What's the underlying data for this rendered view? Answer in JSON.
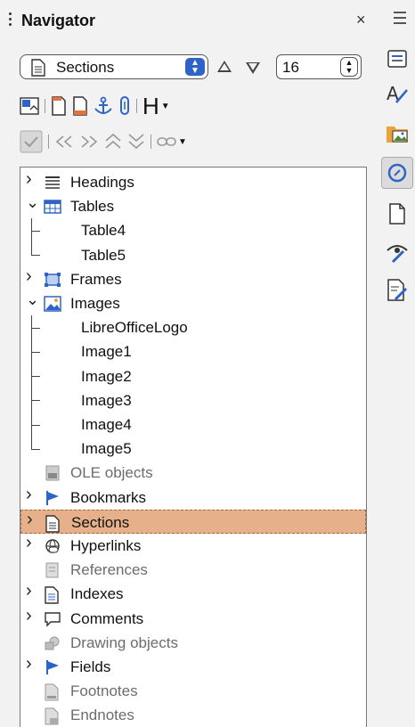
{
  "window": {
    "title": "Navigator",
    "close_glyph": "×",
    "menu_icon": "hamburger-menu-icon"
  },
  "toolbar_row1": {
    "content_type_select": {
      "value": "Sections",
      "icon": "section-icon"
    },
    "heading_level": {
      "value": "16"
    }
  },
  "toolbar_row2": {
    "icons": [
      "toggle-icon",
      "page-icon",
      "page-icon",
      "anchor-icon",
      "attachment-icon",
      "heading-level-icon"
    ],
    "heading_glyph": "H"
  },
  "toolbar_row3": {
    "icons": [
      "checkbox-icon",
      "double-left-arrow-icon",
      "double-right-arrow-icon",
      "promote-chapter-icon",
      "demote-chapter-icon",
      "link-icon"
    ]
  },
  "tree": {
    "items": [
      {
        "label": "Headings",
        "level": 0,
        "expander": "collapsed",
        "icon": "headings-icon",
        "state": "normal"
      },
      {
        "label": "Tables",
        "level": 0,
        "expander": "expanded",
        "icon": "table-icon",
        "state": "normal"
      },
      {
        "label": "Table4",
        "level": 1,
        "expander": "none",
        "icon": "",
        "state": "normal"
      },
      {
        "label": "Table5",
        "level": 1,
        "expander": "none",
        "icon": "",
        "state": "normal"
      },
      {
        "label": "Frames",
        "level": 0,
        "expander": "collapsed",
        "icon": "frame-icon",
        "state": "normal"
      },
      {
        "label": "Images",
        "level": 0,
        "expander": "expanded",
        "icon": "image-icon",
        "state": "normal"
      },
      {
        "label": "LibreOfficeLogo",
        "level": 1,
        "expander": "none",
        "icon": "",
        "state": "normal"
      },
      {
        "label": "Image1",
        "level": 1,
        "expander": "none",
        "icon": "",
        "state": "normal"
      },
      {
        "label": "Image2",
        "level": 1,
        "expander": "none",
        "icon": "",
        "state": "normal"
      },
      {
        "label": "Image3",
        "level": 1,
        "expander": "none",
        "icon": "",
        "state": "normal"
      },
      {
        "label": "Image4",
        "level": 1,
        "expander": "none",
        "icon": "",
        "state": "normal"
      },
      {
        "label": "Image5",
        "level": 1,
        "expander": "none",
        "icon": "",
        "state": "normal"
      },
      {
        "label": "OLE objects",
        "level": 0,
        "expander": "none",
        "icon": "ole-icon",
        "state": "dim"
      },
      {
        "label": "Bookmarks",
        "level": 0,
        "expander": "collapsed",
        "icon": "bookmark-flag-icon",
        "state": "normal"
      },
      {
        "label": "Sections",
        "level": 0,
        "expander": "collapsed",
        "icon": "section-icon",
        "state": "selected"
      },
      {
        "label": "Hyperlinks",
        "level": 0,
        "expander": "collapsed",
        "icon": "hyperlink-icon",
        "state": "normal"
      },
      {
        "label": "References",
        "level": 0,
        "expander": "none",
        "icon": "reference-icon",
        "state": "dim"
      },
      {
        "label": "Indexes",
        "level": 0,
        "expander": "collapsed",
        "icon": "index-icon",
        "state": "normal"
      },
      {
        "label": "Comments",
        "level": 0,
        "expander": "collapsed",
        "icon": "comment-icon",
        "state": "normal"
      },
      {
        "label": "Drawing objects",
        "level": 0,
        "expander": "none",
        "icon": "drawing-icon",
        "state": "dim"
      },
      {
        "label": "Fields",
        "level": 0,
        "expander": "collapsed",
        "icon": "field-flag-icon",
        "state": "normal"
      },
      {
        "label": "Footnotes",
        "level": 0,
        "expander": "none",
        "icon": "footnote-icon",
        "state": "dim"
      },
      {
        "label": "Endnotes",
        "level": 0,
        "expander": "none",
        "icon": "endnote-icon",
        "state": "dim"
      }
    ]
  },
  "sidebar": {
    "buttons": [
      {
        "icon": "properties-icon",
        "active": false
      },
      {
        "icon": "styles-icon",
        "active": false
      },
      {
        "icon": "gallery-icon",
        "active": false
      },
      {
        "icon": "navigator-icon",
        "active": true
      },
      {
        "icon": "page-icon",
        "active": false
      },
      {
        "icon": "style-inspector-icon",
        "active": false
      },
      {
        "icon": "manage-changes-icon",
        "active": false
      }
    ]
  },
  "colors": {
    "selected_row": "#e6b08a",
    "accent_blue": "#2e63c7",
    "panel_bg": "#f2f2f2"
  }
}
